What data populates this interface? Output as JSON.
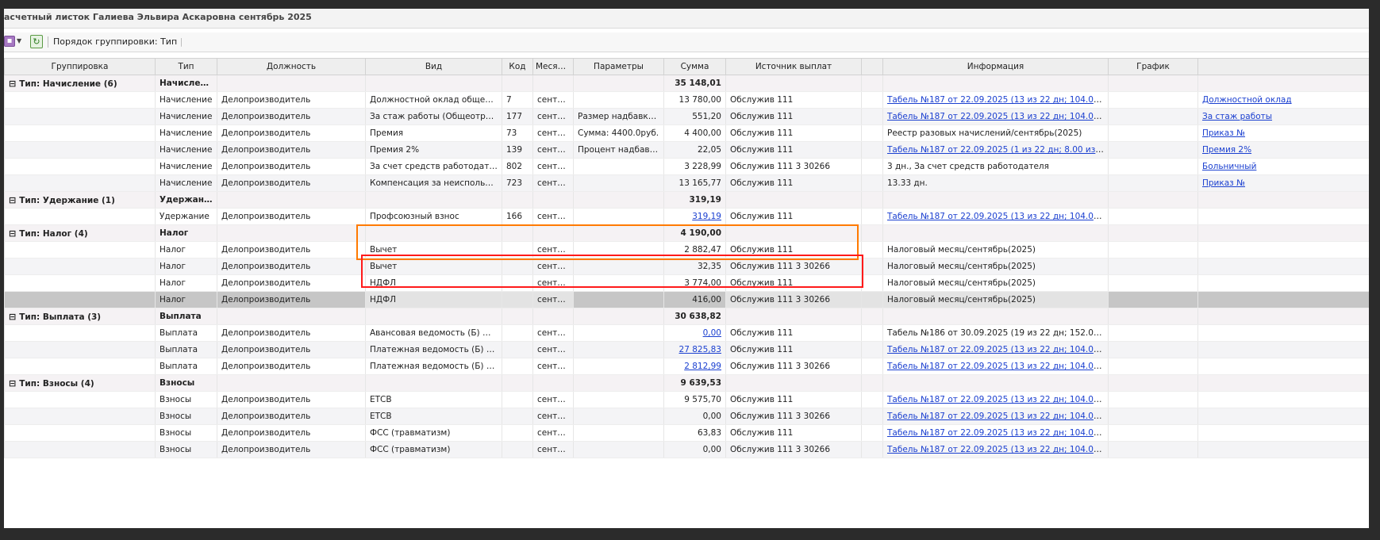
{
  "window": {
    "title": "асчетный листок Галиева Эльвира Аскаровна сентябрь 2025"
  },
  "toolbar": {
    "menu_icon": "menu-square-icon",
    "refresh_icon": "refresh-icon",
    "grouping_label": "Порядок группировки:",
    "grouping_value": "Тип"
  },
  "columns": [
    "Группировка",
    "Тип",
    "Должность",
    "Вид",
    "Код",
    "Месяц ...",
    "Параметры",
    "Сумма",
    "Источник выплат",
    "",
    "Информация",
    "График",
    ""
  ],
  "groups": [
    {
      "label": "Тип: Начисление (6)",
      "type": "Начисление",
      "sum": "35 148,01",
      "rows": [
        {
          "type": "Начисление",
          "position": "Делопроизводитель",
          "kind": "Должностной оклад общеотрасле...",
          "code": "7",
          "month": "сентяб...",
          "params": "",
          "sum": "13 780,00",
          "sum_link": false,
          "source": "Обслужив 111",
          "info": "Табель №187 от 22.09.2025 (13 из 22 дн; 104.00 из 176.0...",
          "info_link": true,
          "extra": "Должностной оклад",
          "extra_link": true
        },
        {
          "type": "Начисление",
          "position": "Делопроизводитель",
          "kind": "За стаж работы (Общеотраслевые)",
          "code": "177",
          "month": "сентяб...",
          "params": "Размер надбавки (%...",
          "sum": "551,20",
          "sum_link": false,
          "source": "Обслужив 111",
          "info": "Табель №187 от 22.09.2025 (13 из 22 дн; 104.00 из 176.0...",
          "info_link": true,
          "extra": "За стаж работы",
          "extra_link": true
        },
        {
          "type": "Начисление",
          "position": "Делопроизводитель",
          "kind": "Премия",
          "code": "73",
          "month": "сентяб...",
          "params": "Сумма: 4400.0руб.",
          "sum": "4 400,00",
          "sum_link": false,
          "source": "Обслужив 111",
          "info": "Реестр разовых начислений/сентябрь(2025)",
          "info_link": false,
          "extra": "Приказ №",
          "extra_link": true
        },
        {
          "type": "Начисление",
          "position": "Делопроизводитель",
          "kind": "Премия 2%",
          "code": "139",
          "month": "сентяб...",
          "params": "Процент надбавки: 2...",
          "sum": "22,05",
          "sum_link": false,
          "source": "Обслужив 111",
          "info": "Табель №187 от 22.09.2025 (1 из 22 дн; 8.00 из 176.00 ч.)",
          "info_link": true,
          "extra": "Премия 2%",
          "extra_link": true
        },
        {
          "type": "Начисление",
          "position": "Делопроизводитель",
          "kind": "За счет средств работодателя",
          "code": "802",
          "month": "сентяб...",
          "params": "",
          "sum": "3 228,99",
          "sum_link": false,
          "source": "Обслужив 111 3 30266",
          "info": "3 дн., За счет средств работодателя",
          "info_link": false,
          "extra": "Больничный",
          "extra_link": true
        },
        {
          "type": "Начисление",
          "position": "Делопроизводитель",
          "kind": "Компенсация за неиспользованн...",
          "code": "723",
          "month": "сентяб...",
          "params": "",
          "sum": "13 165,77",
          "sum_link": false,
          "source": "Обслужив 111",
          "info": "13.33 дн.",
          "info_link": false,
          "extra": "Приказ №",
          "extra_link": true
        }
      ]
    },
    {
      "label": "Тип: Удержание (1)",
      "type": "Удержание",
      "sum": "319,19",
      "rows": [
        {
          "type": "Удержание",
          "position": "Делопроизводитель",
          "kind": "Профсоюзный взнос",
          "code": "166",
          "month": "сентяб...",
          "params": "",
          "sum": "319,19",
          "sum_link": true,
          "source": "Обслужив 111",
          "info": "Табель №187 от 22.09.2025 (13 из 22 дн; 104.00 из 176.0...",
          "info_link": true,
          "extra": "",
          "extra_link": false
        }
      ]
    },
    {
      "label": "Тип: Налог (4)",
      "type": "Налог",
      "sum": "4 190,00",
      "rows": [
        {
          "type": "Налог",
          "position": "Делопроизводитель",
          "kind": "Вычет",
          "code": "",
          "month": "сентяб...",
          "params": "",
          "sum": "2 882,47",
          "sum_link": false,
          "source": "Обслужив 111",
          "info": "Налоговый месяц/сентябрь(2025)",
          "info_link": false,
          "extra": "",
          "extra_link": false
        },
        {
          "type": "Налог",
          "position": "Делопроизводитель",
          "kind": "Вычет",
          "code": "",
          "month": "сентяб...",
          "params": "",
          "sum": "32,35",
          "sum_link": false,
          "source": "Обслужив 111 3 30266",
          "info": "Налоговый месяц/сентябрь(2025)",
          "info_link": false,
          "extra": "",
          "extra_link": false
        },
        {
          "type": "Налог",
          "position": "Делопроизводитель",
          "kind": "НДФЛ",
          "code": "",
          "month": "сентяб...",
          "params": "",
          "sum": "3 774,00",
          "sum_link": false,
          "source": "Обслужив 111",
          "info": "Налоговый месяц/сентябрь(2025)",
          "info_link": false,
          "extra": "",
          "extra_link": false
        },
        {
          "type": "Налог",
          "position": "Делопроизводитель",
          "kind": "НДФЛ",
          "code": "",
          "month": "сентяб...",
          "params": "",
          "sum": "416,00",
          "sum_link": false,
          "source": "Обслужив 111 3 30266",
          "info": "Налоговый месяц/сентябрь(2025)",
          "info_link": false,
          "extra": "",
          "extra_link": false,
          "selected": true
        }
      ]
    },
    {
      "label": "Тип: Выплата (3)",
      "type": "Выплата",
      "sum": "30 638,82",
      "rows": [
        {
          "type": "Выплата",
          "position": "Делопроизводитель",
          "kind": "Авансовая ведомость (Б) №65 от...",
          "code": "",
          "month": "сентяб...",
          "params": "",
          "sum": "0,00",
          "sum_link": true,
          "source": "Обслужив 111",
          "info": "Табель №186 от 30.09.2025 (19 из 22 дн; 152.00 из 176....",
          "info_link": false,
          "extra": "",
          "extra_link": false
        },
        {
          "type": "Выплата",
          "position": "Делопроизводитель",
          "kind": "Платежная ведомость (Б) №68 о...",
          "code": "",
          "month": "сентяб...",
          "params": "",
          "sum": "27 825,83",
          "sum_link": true,
          "source": "Обслужив 111",
          "info": "Табель №187 от 22.09.2025 (13 из 22 дн; 104.00 из 176.0...",
          "info_link": true,
          "extra": "",
          "extra_link": false
        },
        {
          "type": "Выплата",
          "position": "Делопроизводитель",
          "kind": "Платежная ведомость (Б) №69 о...",
          "code": "",
          "month": "сентяб...",
          "params": "",
          "sum": "2 812,99",
          "sum_link": true,
          "source": "Обслужив 111 3 30266",
          "info": "Табель №187 от 22.09.2025 (13 из 22 дн; 104.00 из 176.0...",
          "info_link": true,
          "extra": "",
          "extra_link": false
        }
      ]
    },
    {
      "label": "Тип: Взносы (4)",
      "type": "Взносы",
      "sum": "9 639,53",
      "rows": [
        {
          "type": "Взносы",
          "position": "Делопроизводитель",
          "kind": "ЕТСВ",
          "code": "",
          "month": "сентяб...",
          "params": "",
          "sum": "9 575,70",
          "sum_link": false,
          "source": "Обслужив 111",
          "info": "Табель №187 от 22.09.2025 (13 из 22 дн; 104.00 из 176.0...",
          "info_link": true,
          "extra": "",
          "extra_link": false
        },
        {
          "type": "Взносы",
          "position": "Делопроизводитель",
          "kind": "ЕТСВ",
          "code": "",
          "month": "сентяб...",
          "params": "",
          "sum": "0,00",
          "sum_link": false,
          "source": "Обслужив 111 3 30266",
          "info": "Табель №187 от 22.09.2025 (13 из 22 дн; 104.00 из 176.0...",
          "info_link": true,
          "extra": "",
          "extra_link": false
        },
        {
          "type": "Взносы",
          "position": "Делопроизводитель",
          "kind": "ФСС (травматизм)",
          "code": "",
          "month": "сентяб...",
          "params": "",
          "sum": "63,83",
          "sum_link": false,
          "source": "Обслужив 111",
          "info": "Табель №187 от 22.09.2025 (13 из 22 дн; 104.00 из 176.0...",
          "info_link": true,
          "extra": "",
          "extra_link": false
        },
        {
          "type": "Взносы",
          "position": "Делопроизводитель",
          "kind": "ФСС (травматизм)",
          "code": "",
          "month": "сентяб...",
          "params": "",
          "sum": "0,00",
          "sum_link": false,
          "source": "Обслужив 111 3 30266",
          "info": "Табель №187 от 22.09.2025 (13 из 22 дн; 104.00 из 176.0...",
          "info_link": true,
          "extra": "",
          "extra_link": false
        }
      ]
    }
  ],
  "annotations": {
    "orange_color": "#ff7a00",
    "red_color": "#ff1a1a"
  }
}
